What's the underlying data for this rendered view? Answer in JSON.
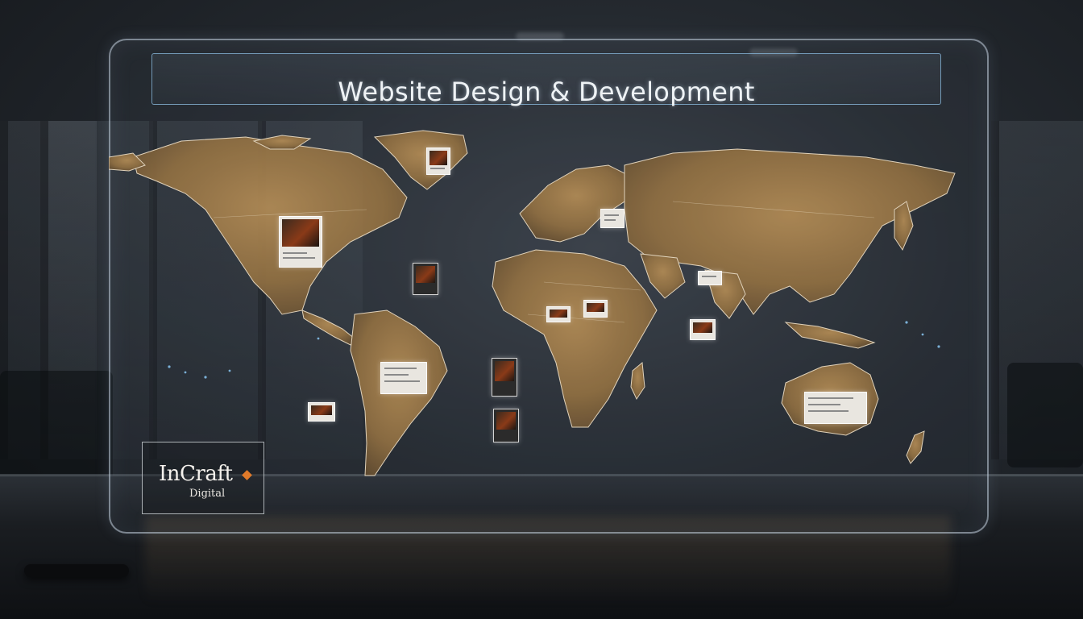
{
  "panel": {
    "title": "Website Design & Development"
  },
  "logo": {
    "name": "InCraft",
    "tagline": "Digital"
  },
  "colors": {
    "land": "#9a7a4e",
    "land_edge": "#e8d6b6",
    "hologram_border": "#c8d7e6",
    "accent": "#e07a2a"
  }
}
